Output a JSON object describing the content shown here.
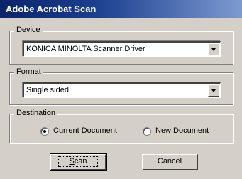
{
  "window": {
    "title": "Adobe Acrobat Scan"
  },
  "device": {
    "legend": "Device",
    "selected": "KONICA MINOLTA Scanner Driver"
  },
  "format": {
    "legend": "Format",
    "selected": "Single sided"
  },
  "destination": {
    "legend": "Destination",
    "options": [
      {
        "label": "Current Document",
        "selected": true
      },
      {
        "label": "New Document",
        "selected": false
      }
    ]
  },
  "buttons": {
    "scan_label": "Scan",
    "cancel_label": "Cancel"
  },
  "icons": {
    "dropdown": "chevron-down-icon"
  },
  "colors": {
    "titlebar_start": "#0a246a",
    "titlebar_end": "#7d9ad0",
    "dialog_face": "#d4d0c8"
  }
}
